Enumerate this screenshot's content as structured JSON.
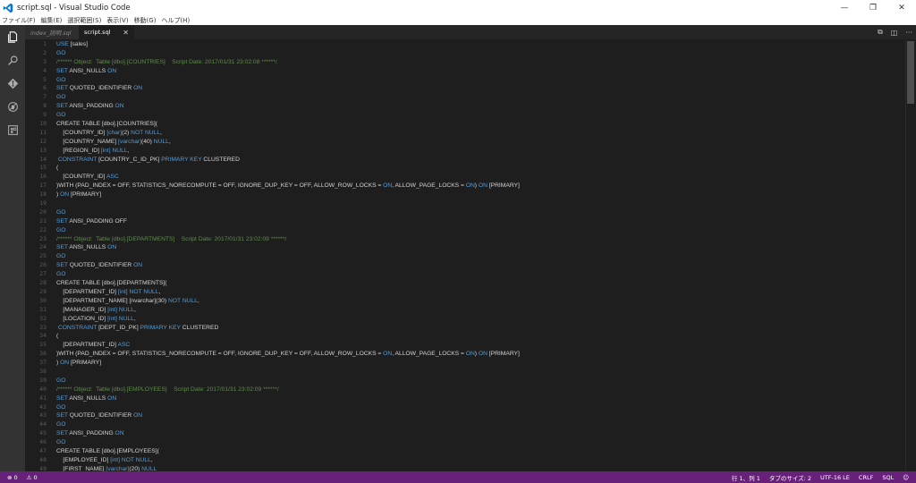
{
  "window": {
    "title": "script.sql - Visual Studio Code",
    "controls": [
      "—",
      "❐",
      "✕"
    ]
  },
  "menubar": [
    "ファイル(F)",
    "編集(E)",
    "選択範囲(S)",
    "表示(V)",
    "移動(G)",
    "ヘルプ(H)"
  ],
  "activitybar": [
    "explorer-icon",
    "search-icon",
    "git-icon",
    "debug-icon",
    "extensions-icon"
  ],
  "tabs": [
    {
      "label": "index_説明.sql",
      "active": false
    },
    {
      "label": "script.sql",
      "active": true
    }
  ],
  "tab_actions": [
    "⧉",
    "◫",
    "···"
  ],
  "editor": {
    "lines": [
      [
        [
          "kw",
          "USE "
        ],
        [
          "t",
          "[sales]"
        ]
      ],
      [
        [
          "kw",
          "GO"
        ]
      ],
      [
        [
          "cm",
          "/****** Object:  Table [dbo].[COUNTRIES]    Script Date: 2017/01/31 23:02:08 ******/"
        ]
      ],
      [
        [
          "kw",
          "SET "
        ],
        [
          "t",
          "ANSI_NULLS "
        ],
        [
          "kw",
          "ON"
        ]
      ],
      [
        [
          "kw",
          "GO"
        ]
      ],
      [
        [
          "kw",
          "SET "
        ],
        [
          "t",
          "QUOTED_IDENTIFIER "
        ],
        [
          "kw",
          "ON"
        ]
      ],
      [
        [
          "kw",
          "GO"
        ]
      ],
      [
        [
          "kw",
          "SET "
        ],
        [
          "t",
          "ANSI_PADDING "
        ],
        [
          "kw",
          "ON"
        ]
      ],
      [
        [
          "kw",
          "GO"
        ]
      ],
      [
        [
          "t",
          "CREATE TABLE [dbo].[COUNTRIES]("
        ]
      ],
      [
        [
          "t",
          "    [COUNTRY_ID] "
        ],
        [
          "kw",
          "[char]"
        ],
        [
          "t",
          "(2) "
        ],
        [
          "kw",
          "NOT NULL"
        ],
        [
          "t",
          ","
        ]
      ],
      [
        [
          "t",
          "    [COUNTRY_NAME] "
        ],
        [
          "kw",
          "[varchar]"
        ],
        [
          "t",
          "(40) "
        ],
        [
          "kw",
          "NULL"
        ],
        [
          "t",
          ","
        ]
      ],
      [
        [
          "t",
          "    [REGION_ID] "
        ],
        [
          "kw",
          "[int]"
        ],
        [
          "t",
          " "
        ],
        [
          "kw",
          "NULL"
        ],
        [
          "t",
          ","
        ]
      ],
      [
        [
          "kw",
          " CONSTRAINT "
        ],
        [
          "t",
          "[COUNTRY_C_ID_PK] "
        ],
        [
          "kw",
          "PRIMARY KEY "
        ],
        [
          "t",
          "CLUSTERED"
        ]
      ],
      [
        [
          "t",
          "("
        ]
      ],
      [
        [
          "t",
          "    [COUNTRY_ID] "
        ],
        [
          "kw",
          "ASC"
        ]
      ],
      [
        [
          "t",
          ")WITH (PAD_INDEX = OFF, STATISTICS_NORECOMPUTE = OFF, IGNORE_DUP_KEY = OFF, ALLOW_ROW_LOCKS = "
        ],
        [
          "kw",
          "ON"
        ],
        [
          "t",
          ", ALLOW_PAGE_LOCKS = "
        ],
        [
          "kw",
          "ON"
        ],
        [
          "t",
          ") "
        ],
        [
          "kw",
          "ON "
        ],
        [
          "t",
          "[PRIMARY]"
        ]
      ],
      [
        [
          "t",
          ") "
        ],
        [
          "kw",
          "ON "
        ],
        [
          "t",
          "[PRIMARY]"
        ]
      ],
      [],
      [
        [
          "kw",
          "GO"
        ]
      ],
      [
        [
          "kw",
          "SET "
        ],
        [
          "t",
          "ANSI_PADDING OFF"
        ]
      ],
      [
        [
          "kw",
          "GO"
        ]
      ],
      [
        [
          "cm",
          "/****** Object:  Table [dbo].[DEPARTMENTS]    Script Date: 2017/01/31 23:02:09 ******/"
        ]
      ],
      [
        [
          "kw",
          "SET "
        ],
        [
          "t",
          "ANSI_NULLS "
        ],
        [
          "kw",
          "ON"
        ]
      ],
      [
        [
          "kw",
          "GO"
        ]
      ],
      [
        [
          "kw",
          "SET "
        ],
        [
          "t",
          "QUOTED_IDENTIFIER "
        ],
        [
          "kw",
          "ON"
        ]
      ],
      [
        [
          "kw",
          "GO"
        ]
      ],
      [
        [
          "t",
          "CREATE TABLE [dbo].[DEPARTMENTS]("
        ]
      ],
      [
        [
          "t",
          "    [DEPARTMENT_ID] "
        ],
        [
          "kw",
          "[int]"
        ],
        [
          "t",
          " "
        ],
        [
          "kw",
          "NOT NULL"
        ],
        [
          "t",
          ","
        ]
      ],
      [
        [
          "t",
          "    [DEPARTMENT_NAME] [nvarchar](30) "
        ],
        [
          "kw",
          "NOT NULL"
        ],
        [
          "t",
          ","
        ]
      ],
      [
        [
          "t",
          "    [MANAGER_ID] "
        ],
        [
          "kw",
          "[int]"
        ],
        [
          "t",
          " "
        ],
        [
          "kw",
          "NULL"
        ],
        [
          "t",
          ","
        ]
      ],
      [
        [
          "t",
          "    [LOCATION_ID] "
        ],
        [
          "kw",
          "[int]"
        ],
        [
          "t",
          " "
        ],
        [
          "kw",
          "NULL"
        ],
        [
          "t",
          ","
        ]
      ],
      [
        [
          "kw",
          " CONSTRAINT "
        ],
        [
          "t",
          "[DEPT_ID_PK] "
        ],
        [
          "kw",
          "PRIMARY KEY "
        ],
        [
          "t",
          "CLUSTERED"
        ]
      ],
      [
        [
          "t",
          "("
        ]
      ],
      [
        [
          "t",
          "    [DEPARTMENT_ID] "
        ],
        [
          "kw",
          "ASC"
        ]
      ],
      [
        [
          "t",
          ")WITH (PAD_INDEX = OFF, STATISTICS_NORECOMPUTE = OFF, IGNORE_DUP_KEY = OFF, ALLOW_ROW_LOCKS = "
        ],
        [
          "kw",
          "ON"
        ],
        [
          "t",
          ", ALLOW_PAGE_LOCKS = "
        ],
        [
          "kw",
          "ON"
        ],
        [
          "t",
          ") "
        ],
        [
          "kw",
          "ON "
        ],
        [
          "t",
          "[PRIMARY]"
        ]
      ],
      [
        [
          "t",
          ") "
        ],
        [
          "kw",
          "ON "
        ],
        [
          "t",
          "[PRIMARY]"
        ]
      ],
      [],
      [
        [
          "kw",
          "GO"
        ]
      ],
      [
        [
          "cm",
          "/****** Object:  Table [dbo].[EMPLOYEES]    Script Date: 2017/01/31 23:02:09 ******/"
        ]
      ],
      [
        [
          "kw",
          "SET "
        ],
        [
          "t",
          "ANSI_NULLS "
        ],
        [
          "kw",
          "ON"
        ]
      ],
      [
        [
          "kw",
          "GO"
        ]
      ],
      [
        [
          "kw",
          "SET "
        ],
        [
          "t",
          "QUOTED_IDENTIFIER "
        ],
        [
          "kw",
          "ON"
        ]
      ],
      [
        [
          "kw",
          "GO"
        ]
      ],
      [
        [
          "kw",
          "SET "
        ],
        [
          "t",
          "ANSI_PADDING "
        ],
        [
          "kw",
          "ON"
        ]
      ],
      [
        [
          "kw",
          "GO"
        ]
      ],
      [
        [
          "t",
          "CREATE TABLE [dbo].[EMPLOYEES]("
        ]
      ],
      [
        [
          "t",
          "    [EMPLOYEE_ID] "
        ],
        [
          "kw",
          "[int]"
        ],
        [
          "t",
          " "
        ],
        [
          "kw",
          "NOT NULL"
        ],
        [
          "t",
          ","
        ]
      ],
      [
        [
          "t",
          "    [FIRST_NAME] "
        ],
        [
          "kw",
          "[varchar]"
        ],
        [
          "t",
          "(20) "
        ],
        [
          "kw",
          "NULL"
        ]
      ]
    ]
  },
  "statusbar": {
    "left": [
      "⊗ 0",
      "⚠ 0"
    ],
    "right": [
      "行 1、列 1",
      "タブのサイズ: 2",
      "UTF-16 LE",
      "CRLF",
      "SQL",
      "☺"
    ]
  },
  "colors": {
    "statusbar": "#68217a",
    "keyword": "#569cd6",
    "comment": "#608b4e",
    "text": "#d4d4d4"
  }
}
